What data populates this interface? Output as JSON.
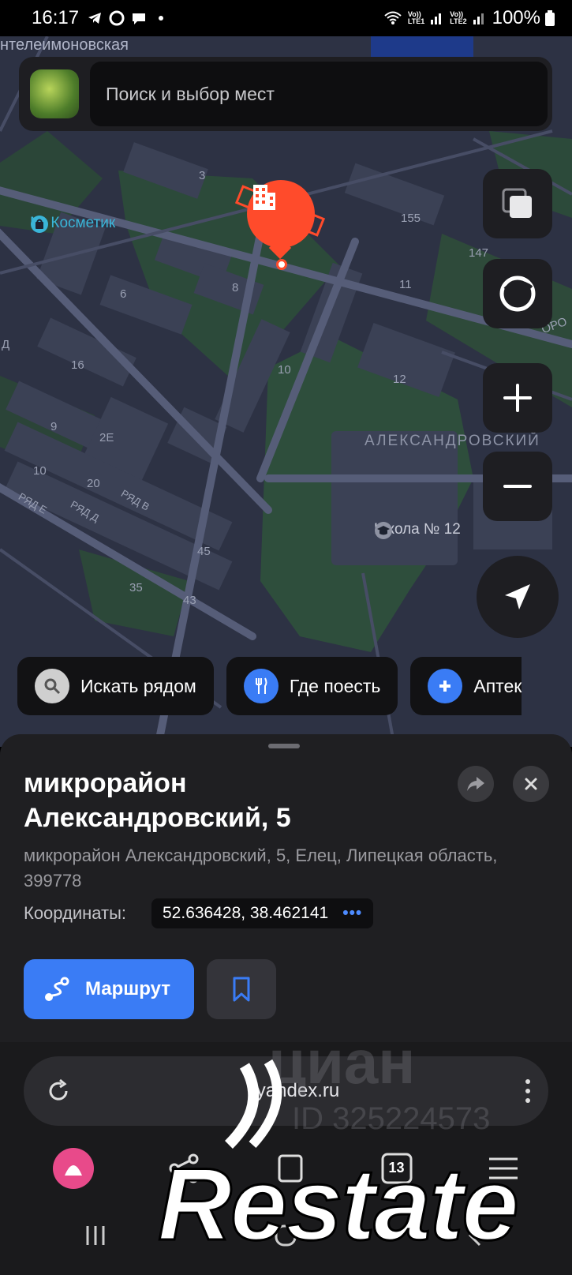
{
  "status_bar": {
    "time": "16:17",
    "sim1": "LTE1",
    "sim2": "LTE2",
    "battery": "100%"
  },
  "map": {
    "street_top": "нтелеимоновская",
    "district_label": "АЛЕКСАНДРОВСКИЙ",
    "street_right": "ОРО",
    "poi_cosmetic": "М. Косметик",
    "poi_school": "Школа № 12",
    "house_numbers": [
      "3",
      "155",
      "147",
      "6",
      "8",
      "11",
      "16",
      "10",
      "12",
      "9",
      "2Е",
      "10",
      "20",
      "45",
      "35",
      "43",
      "Д"
    ],
    "row_labels": [
      "РЯД В",
      "РЯД Д",
      "РЯД Е"
    ]
  },
  "search": {
    "placeholder": "Поиск и выбор мест"
  },
  "chips": [
    {
      "label": "Искать рядом",
      "icon": "search-icon",
      "color": "#cfcfcf"
    },
    {
      "label": "Где поесть",
      "icon": "fork-knife-icon",
      "color": "#3a7cf5"
    },
    {
      "label": "Аптек",
      "icon": "plus-icon",
      "color": "#3a7cf5"
    }
  ],
  "card": {
    "title": "микрорайон Александровский, 5",
    "address": "микрорайон Александровский, 5, Елец, Липецкая область, 399778",
    "coords_label": "Координаты:",
    "coords_value": "52.636428, 38.462141",
    "coords_more": "•••",
    "route_label": "Маршрут"
  },
  "browser": {
    "url": "yandex.ru",
    "tabs_count": "13"
  },
  "watermarks": {
    "cian": "циан",
    "cian_id": "ID 325224573",
    "restate": "Restate"
  },
  "colors": {
    "accent": "#3a7cf5",
    "pin": "#ff4b2b",
    "poi_cyan": "#3ab5d8",
    "map_bg": "#2b3040"
  }
}
